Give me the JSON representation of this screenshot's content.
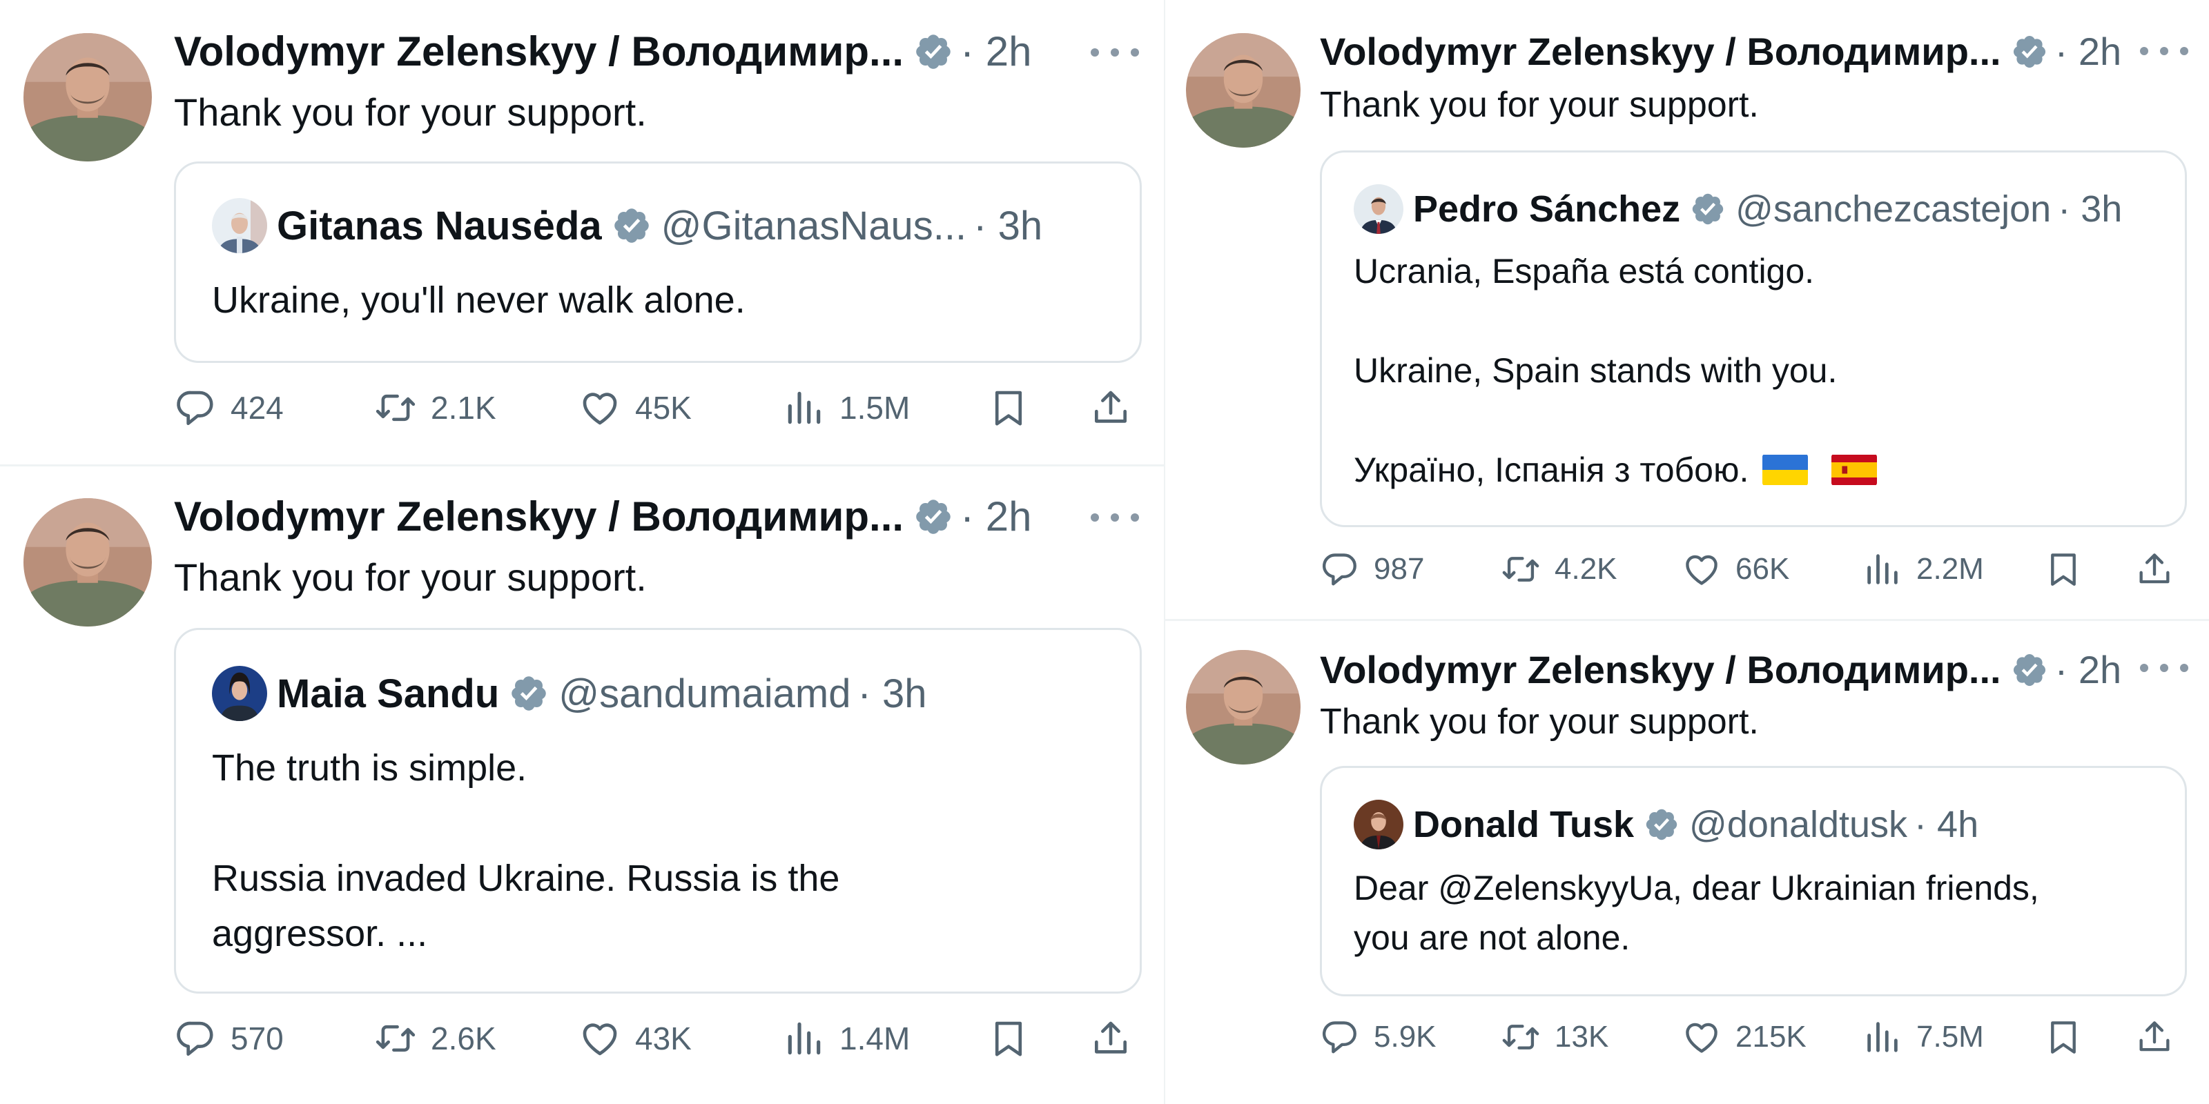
{
  "colors": {
    "text": "#0f1419",
    "secondary": "#536471",
    "verified": "#829aab",
    "border": "#dfe5e9",
    "divider": "#eff3f4"
  },
  "icons": [
    "reply-icon",
    "retweet-icon",
    "like-icon",
    "views-icon",
    "bookmark-icon",
    "share-icon",
    "verified-badge-icon",
    "more-icon"
  ],
  "tweets": [
    {
      "author": "Volodymyr Zelenskyy / Володимир...",
      "time": "2h",
      "text": "Thank you for your support.",
      "quote": {
        "name": "Gitanas Nausėda",
        "handle": "@GitanasNaus...",
        "time": "3h",
        "lines": [
          "Ukraine, you'll never walk alone."
        ]
      },
      "stats": {
        "replies": "424",
        "reposts": "2.1K",
        "likes": "45K",
        "views": "1.5M"
      }
    },
    {
      "author": "Volodymyr Zelenskyy / Володимир...",
      "time": "2h",
      "text": "Thank you for your support.",
      "quote": {
        "name": "Maia Sandu",
        "handle": "@sandumaiamd",
        "time": "3h",
        "lines": [
          "The truth is simple.",
          "Russia invaded Ukraine. Russia is the",
          "aggressor. ..."
        ]
      },
      "stats": {
        "replies": "570",
        "reposts": "2.6K",
        "likes": "43K",
        "views": "1.4M"
      }
    },
    {
      "author": "Volodymyr Zelenskyy / Володимир...",
      "time": "2h",
      "text": "Thank you for your support.",
      "quote": {
        "name": "Pedro Sánchez",
        "handle": "@sanchezcastejon",
        "time": "3h",
        "lines": [
          "Ucrania, España está contigo.",
          "Ukraine, Spain stands with you.",
          "Україно, Іспанія з тобою."
        ],
        "flags": [
          "ukraine-flag",
          "spain-flag"
        ]
      },
      "stats": {
        "replies": "987",
        "reposts": "4.2K",
        "likes": "66K",
        "views": "2.2M"
      }
    },
    {
      "author": "Volodymyr Zelenskyy / Володимир...",
      "time": "2h",
      "text": "Thank you for your support.",
      "quote": {
        "name": "Donald Tusk",
        "handle": "@donaldtusk",
        "time": "4h",
        "lines": [
          "Dear @ZelenskyyUa, dear Ukrainian friends,",
          "you are not alone."
        ]
      },
      "stats": {
        "replies": "5.9K",
        "reposts": "13K",
        "likes": "215K",
        "views": "7.5M"
      }
    }
  ]
}
